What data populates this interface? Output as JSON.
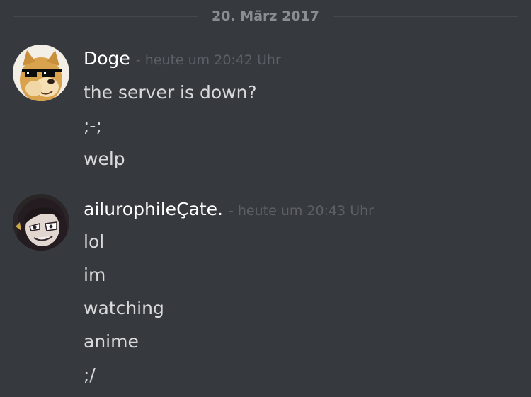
{
  "date_divider": "20. März 2017",
  "messages": [
    {
      "username": "Doge",
      "timestamp": "- heute um 20:42 Uhr",
      "lines": [
        "the server is down?",
        ";-;",
        "welp"
      ]
    },
    {
      "username": "ailurophileÇate.",
      "timestamp": "- heute um 20:43 Uhr",
      "lines": [
        "lol",
        "im",
        "watching",
        "anime",
        ";/"
      ]
    }
  ]
}
